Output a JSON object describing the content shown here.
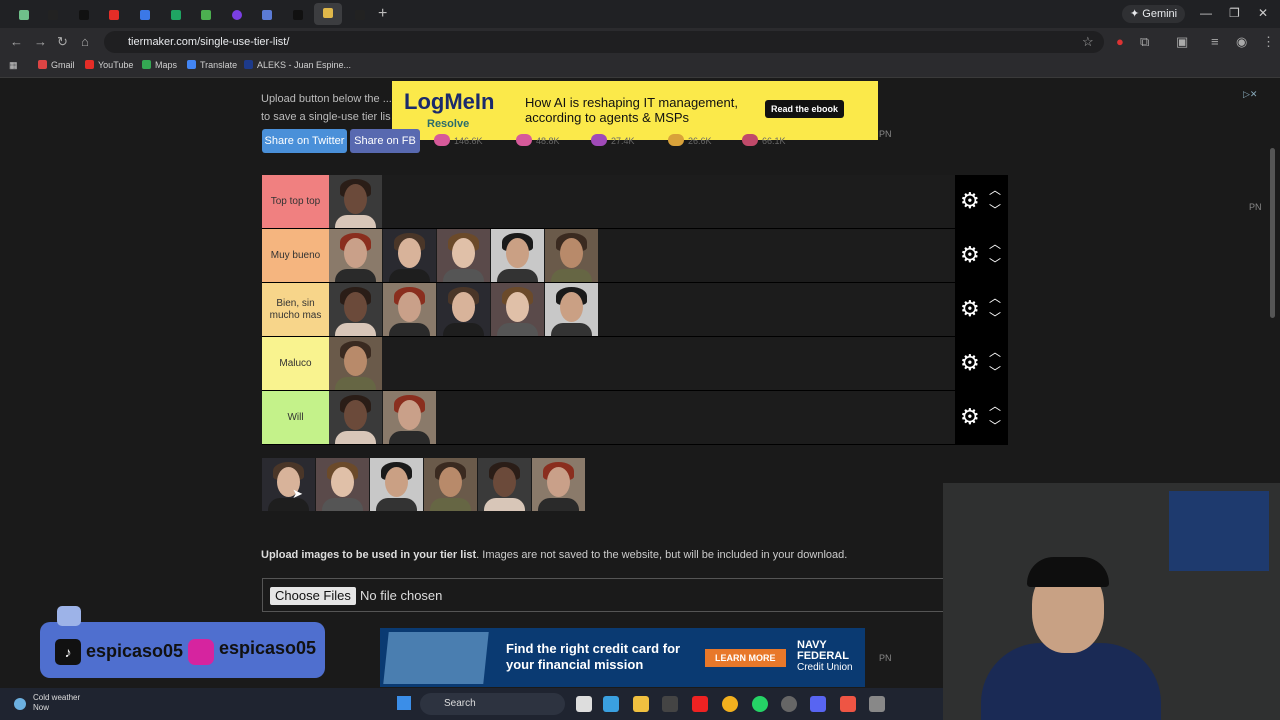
{
  "browser": {
    "url": "tiermaker.com/single-use-tier-list/",
    "gemini_label": "Gemini",
    "bookmarks": [
      "Gmail",
      "YouTube",
      "Maps",
      "Translate",
      "ALEKS - Juan Espine..."
    ]
  },
  "page": {
    "intro_line1": "Upload button below the ...                                                                                  images. It is not possible",
    "intro_line2": "to save a single-use tier lis",
    "share_twitter": "Share on Twitter",
    "share_fb": "Share on FB",
    "reactions": [
      "146.6K",
      "48.8K",
      "27.4K",
      "26.6K",
      "66.1K"
    ],
    "pn": "PN",
    "tiers": [
      {
        "label": "Top top top",
        "color": "#f08080",
        "count": 1
      },
      {
        "label": "Muy bueno",
        "color": "#f5b57f",
        "count": 5
      },
      {
        "label": "Bien, sin mucho mas",
        "color": "#f7d58a",
        "count": 5
      },
      {
        "label": "Maluco",
        "color": "#f9f38f",
        "count": 1
      },
      {
        "label": "Will",
        "color": "#c4f28a",
        "count": 2
      }
    ],
    "pool_count": 6,
    "upload_bold": "Upload images to be used in your tier list",
    "upload_rest": ". Images are not saved to the website, but will be included in your download.",
    "choose_files": "Choose Files",
    "no_file": "No file chosen"
  },
  "ads": {
    "top": {
      "brand": "LogMeIn",
      "product": "Resolve",
      "text": "How AI is reshaping IT management, according to agents & MSPs",
      "cta": "Read the ebook"
    },
    "bottom": {
      "text": "Find the right credit card for your financial mission",
      "cta": "LEARN MORE",
      "brand": "NAVY FEDERAL",
      "brand_sub": "Credit Union"
    }
  },
  "overlay": {
    "tiktok_handle": "espicaso05",
    "instagram_handle": "espicaso05"
  },
  "taskbar": {
    "weather_title": "Cold weather",
    "weather_sub": "Now",
    "search": "Search"
  }
}
